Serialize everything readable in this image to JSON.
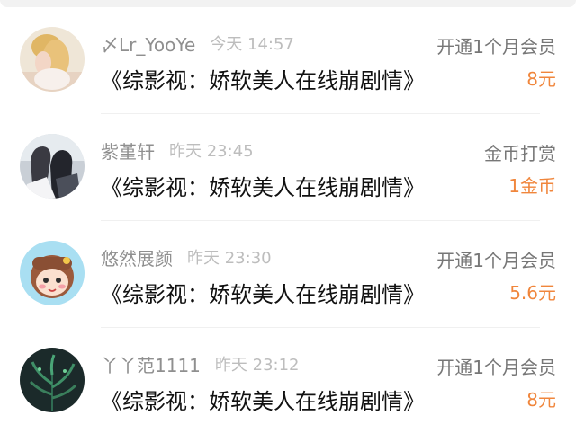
{
  "colors": {
    "amount_orange": "#f0863c",
    "username_gray": "#8f8f8f",
    "time_gray": "#bdbdbd"
  },
  "rewards": [
    {
      "username": "〆Lr_YooYe",
      "time": "今天 14:57",
      "work_title": "《综影视：娇软美人在线崩剧情》",
      "reward_type": "开通1个月会员",
      "amount": "8元",
      "avatar_icon": "blonde-girl-avatar"
    },
    {
      "username": "紫堇轩",
      "time": "昨天 23:45",
      "work_title": "《综影视：娇软美人在线崩剧情》",
      "reward_type": "金币打赏",
      "amount": "1金币",
      "avatar_icon": "drama-couple-avatar"
    },
    {
      "username": "悠然展颜",
      "time": "昨天 23:30",
      "work_title": "《综影视：娇软美人在线崩剧情》",
      "reward_type": "开通1个月会员",
      "amount": "5.6元",
      "avatar_icon": "cartoon-girl-avatar"
    },
    {
      "username": "丫丫范1111",
      "time": "昨天 23:12",
      "work_title": "《综影视：娇软美人在线崩剧情》",
      "reward_type": "开通1个月会员",
      "amount": "8元",
      "avatar_icon": "green-plant-avatar"
    }
  ]
}
